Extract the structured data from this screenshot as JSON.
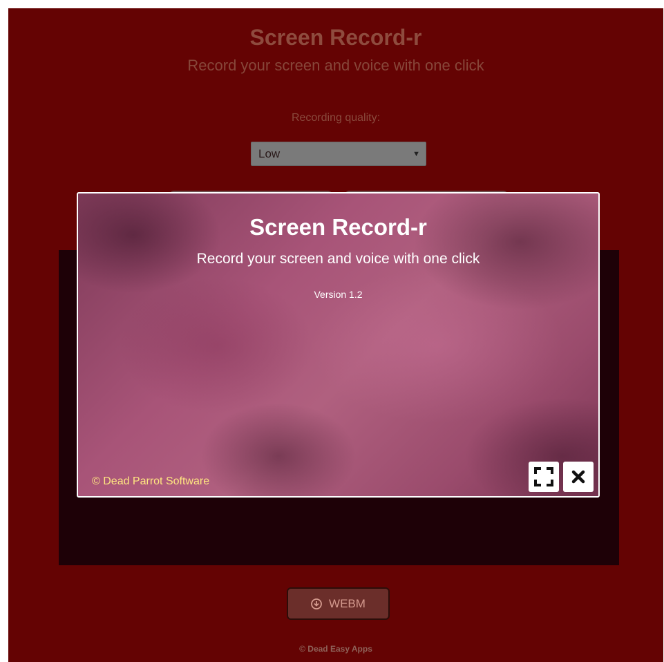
{
  "app": {
    "title": "Screen Record-r",
    "subtitle": "Record your screen and voice with one click",
    "quality_label": "Recording quality:",
    "quality_selected": "Low",
    "webm_button_label": "WEBM",
    "footer": "© Dead Easy Apps"
  },
  "modal": {
    "title": "Screen Record-r",
    "subtitle": "Record your screen and voice with one click",
    "version": "Version 1.2",
    "copyright": "© Dead Parrot Software",
    "buttons": {
      "fullscreen_icon": "fullscreen-icon",
      "close_icon": "close-icon"
    }
  },
  "colors": {
    "app_background": "#640303",
    "modal_border": "#ffffff",
    "copyright_text": "#ffe680"
  }
}
